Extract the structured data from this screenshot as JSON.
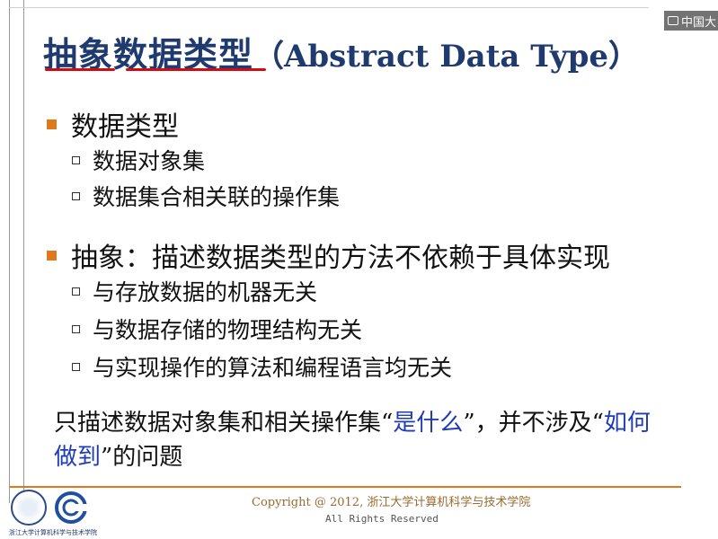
{
  "watermark": "中国大",
  "title": {
    "cn": "抽象数据类型",
    "en": "（Abstract Data Type）"
  },
  "sections": [
    {
      "heading": "数据类型",
      "items": [
        "数据对象集",
        "数据集合相关联的操作集"
      ]
    },
    {
      "heading": "抽象：描述数据类型的方法不依赖于具体实现",
      "items": [
        "与存放数据的机器无关",
        "与数据存储的物理结构无关",
        "与实现操作的算法和编程语言均无关"
      ]
    }
  ],
  "summary": {
    "part1": "只描述数据对象集和相关操作集“",
    "highlight1": "是什么",
    "part2": "”，并不涉及“",
    "highlight2": "如何做到",
    "part3": "”的问题"
  },
  "footer": {
    "copyright": "Copyright @ 2012, 浙江大学计算机科学与技术学院",
    "rights": "All Rights Reserved",
    "logo_caption": "浙江大学计算机科学与技术学院"
  },
  "colors": {
    "title": "#1f3a6e",
    "underline": "#d10d14",
    "bullet": "#e0781e",
    "highlight": "#1f3bb5"
  }
}
